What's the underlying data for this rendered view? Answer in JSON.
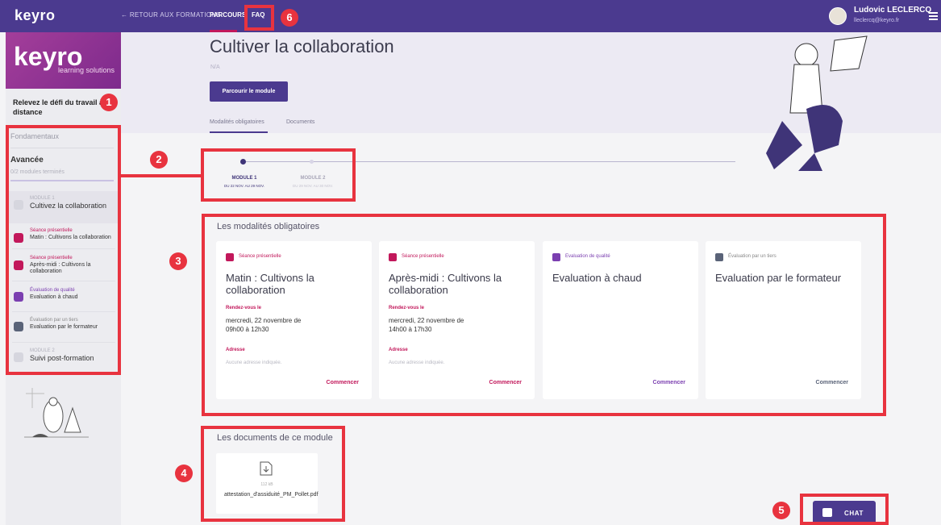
{
  "topbar": {
    "logo": "keyro",
    "back_label": "← RETOUR AUX FORMATIONS",
    "tab_parcours": "PARCOURS",
    "tab_faq": "FAQ",
    "user_name": "Ludovic LECLERCQ",
    "user_email": "lleclercq@keyro.fr",
    "accent_color": "#4b3a8f"
  },
  "sidebar": {
    "brand_logo": "keyro",
    "brand_sub": "learning solutions",
    "course_title": "Relevez le défi du travail à distance",
    "section_fondamentaux": "Fondamentaux",
    "section_avancee": "Avancée",
    "progress_text": "0/2 modules terminés",
    "progress_fraction": 0,
    "items": [
      {
        "kicker": "MODULE 1",
        "title": "Cultivez la collaboration",
        "icon": "module-icon"
      },
      {
        "kicker": "Séance présentielle",
        "title": "Matin : Cultivons la collaboration",
        "icon": "presentation-icon"
      },
      {
        "kicker": "Séance présentielle",
        "title": "Après-midi : Cultivons la collaboration",
        "icon": "presentation-icon"
      },
      {
        "kicker": "Évaluation de qualité",
        "title": "Evaluation à chaud",
        "icon": "star-icon"
      },
      {
        "kicker": "Évaluation par un tiers",
        "title": "Evaluation par le formateur",
        "icon": "chart-icon"
      },
      {
        "kicker": "MODULE 2",
        "title": "Suivi post-formation",
        "icon": "module-icon"
      }
    ]
  },
  "header": {
    "title": "Cultiver la collaboration",
    "subtitle": "N/A",
    "primary_button": "Parcourir le module",
    "tab_modalites": "Modalités obligatoires",
    "tab_documents": "Documents"
  },
  "timeline": {
    "steps": [
      {
        "label": "MODULE 1",
        "date": "DU 22 NOV. AU 29 NOV."
      },
      {
        "label": "MODULE 2",
        "date": "DU 29 NOV. AU 30 NOV."
      }
    ]
  },
  "modalites": {
    "section_title": "Les modalités obligatoires",
    "cards": [
      {
        "kind": "Séance présentielle",
        "title": "Matin : Cultivons la collaboration",
        "rdv_label": "Rendez-vous le",
        "rdv_value": "mercredi, 22 novembre de 09h00 à 12h30",
        "addr_label": "Adresse",
        "addr_value": "Aucune adresse indiquée.",
        "action": "Commencer",
        "icon": "presentation-icon"
      },
      {
        "kind": "Séance présentielle",
        "title": "Après-midi : Cultivons la collaboration",
        "rdv_label": "Rendez-vous le",
        "rdv_value": "mercredi, 22 novembre de 14h00 à 17h30",
        "addr_label": "Adresse",
        "addr_value": "Aucune adresse indiquée.",
        "action": "Commencer",
        "icon": "presentation-icon"
      },
      {
        "kind": "Evaluation de qualité",
        "title": "Evaluation à chaud",
        "action": "Commencer",
        "icon": "star-icon"
      },
      {
        "kind": "Évaluation par un tiers",
        "title": "Evaluation par le formateur",
        "action": "Commencer",
        "icon": "chart-icon"
      }
    ]
  },
  "documents": {
    "section_title": "Les documents de ce module",
    "file_size": "112 kB",
    "file_name": "attestation_d'assiduité_PM_Pollet.pdf"
  },
  "chat": {
    "label": "CHAT"
  },
  "annotations": [
    "1",
    "2",
    "3",
    "4",
    "5",
    "6"
  ]
}
